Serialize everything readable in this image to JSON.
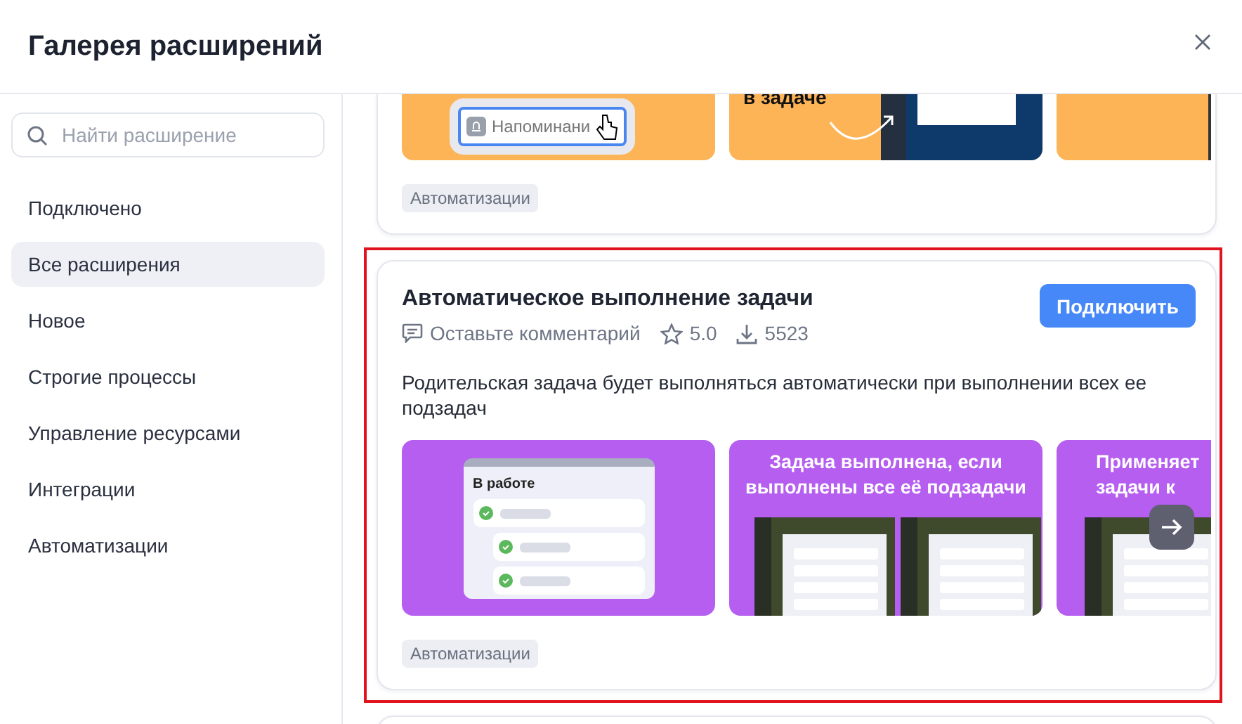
{
  "dialog": {
    "title": "Галерея расширений"
  },
  "sidebar": {
    "search": {
      "placeholder": "Найти расширение"
    },
    "items": [
      {
        "label": "Подключено",
        "selected": false
      },
      {
        "label": "Все расширения",
        "selected": true
      },
      {
        "label": "Новое",
        "selected": false
      },
      {
        "label": "Строгие процессы",
        "selected": false
      },
      {
        "label": "Управление ресурсами",
        "selected": false
      },
      {
        "label": "Интеграции",
        "selected": false
      },
      {
        "label": "Автоматизации",
        "selected": false
      }
    ]
  },
  "extensions": [
    {
      "highlighted": false,
      "slides": [
        {
          "kind": "reminder",
          "color": "#fdb457",
          "lines": [
            "Напоминани"
          ]
        },
        {
          "kind": "arrow",
          "color": "#fdb457",
          "lines": [
            "в задаче"
          ]
        },
        {
          "kind": "screens",
          "color": "#fdb457"
        }
      ],
      "tags": [
        "Автоматизации"
      ]
    },
    {
      "highlighted": true,
      "title": "Автоматическое выполнение задачи",
      "comment": "Оставьте комментарий",
      "rating": "5.0",
      "downloads": "5523",
      "button": "Подключить",
      "description": "Родительская задача будет выполняться автоматически при выполнении всех ее подзадач",
      "slides": [
        {
          "kind": "status",
          "color": "#b55ef0",
          "lines": [
            "В работе"
          ]
        },
        {
          "kind": "compare",
          "color": "#b55ef0",
          "lines": [
            "Задача выполнена, если",
            "выполнены все её подзадачи"
          ]
        },
        {
          "kind": "faded",
          "color": "#b55ef0",
          "lines": [
            "Применяет",
            "задачи к"
          ]
        }
      ],
      "tags": [
        "Автоматизации"
      ]
    }
  ]
}
